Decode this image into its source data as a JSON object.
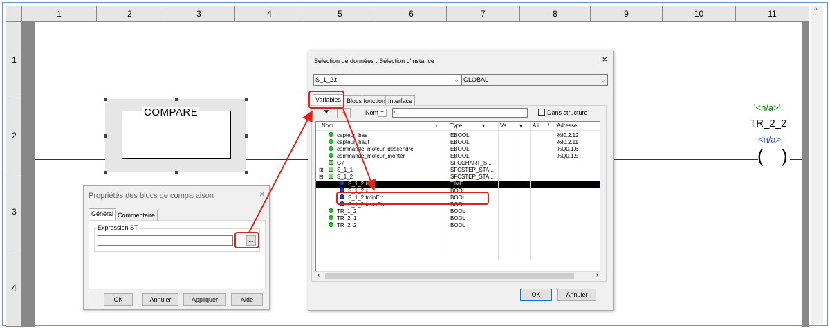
{
  "ladder": {
    "columns": [
      "1",
      "2",
      "3",
      "4",
      "5",
      "6",
      "7",
      "8",
      "9",
      "10",
      "11"
    ],
    "rows": [
      "1",
      "2",
      "3",
      "4"
    ]
  },
  "compare_block": {
    "title": "COMPARE"
  },
  "coil": {
    "assigned": "'<n/a>'",
    "name": "TR_2_2",
    "address": "<n/a>",
    "open": "(",
    "close": ")"
  },
  "properties_dialog": {
    "title": "Propriétés des blocs de comparaison",
    "close": "×",
    "tabs": [
      "Général",
      "Commentaire"
    ],
    "group_label": "Expression ST",
    "expression_value": "",
    "browse_label": "...",
    "buttons": {
      "ok": "OK",
      "cancel": "Annuler",
      "apply": "Appliquer",
      "help": "Aide"
    }
  },
  "selection_dialog": {
    "title": "Sélection de données : Sélection d'instance",
    "close": "×",
    "instance_value": "S_1_2.t",
    "scope_value": "GLOBAL",
    "tabs": [
      "Variables",
      "Blocs fonction",
      "Interface"
    ],
    "filter": {
      "name_label": "Nom",
      "equals": "=",
      "value": "*",
      "structure_label": "Dans structure"
    },
    "columns": [
      "Nom",
      "Type",
      "Va...",
      "Ali...",
      "Adresse"
    ],
    "rows": [
      {
        "indent": 0,
        "icon": "green",
        "name": "capteur_bas",
        "type": "EBOOL",
        "address": "%I0.2.12"
      },
      {
        "indent": 0,
        "icon": "green",
        "name": "capteur_haut",
        "type": "EBOOL",
        "address": "%I0.2.11"
      },
      {
        "indent": 0,
        "icon": "green",
        "name": "commande_moteur_descendre",
        "type": "EBOOL",
        "address": "%Q0.1.6"
      },
      {
        "indent": 0,
        "icon": "green",
        "name": "commande_moteur_monter",
        "type": "EBOOL",
        "address": "%Q0.1.5"
      },
      {
        "indent": 0,
        "icon": "sq",
        "name": "G7",
        "type": "SFCCHART_S...",
        "address": ""
      },
      {
        "indent": 0,
        "icon": "sq",
        "name": "S_1_1",
        "type": "SFCSTEP_STA...",
        "address": "",
        "expander": "⊞"
      },
      {
        "indent": 0,
        "icon": "sq",
        "name": "S_1_2",
        "type": "SFCSTEP_STA...",
        "address": "",
        "expander": "⊟"
      },
      {
        "indent": 1,
        "icon": "blue",
        "name": "S_1_2.t",
        "type": "TIME",
        "address": "",
        "selected": true
      },
      {
        "indent": 1,
        "icon": "blue",
        "name": "S_1_2.x",
        "type": "BOOL",
        "address": ""
      },
      {
        "indent": 1,
        "icon": "blue",
        "name": "S_1_2.tminErr",
        "type": "BOOL",
        "address": ""
      },
      {
        "indent": 1,
        "icon": "blue",
        "name": "S_1_2.tmaxErr",
        "type": "BOOL",
        "address": ""
      },
      {
        "indent": 0,
        "icon": "green",
        "name": "TR_1_2",
        "type": "BOOL",
        "address": ""
      },
      {
        "indent": 0,
        "icon": "green",
        "name": "TR_2_1",
        "type": "BOOL",
        "address": ""
      },
      {
        "indent": 0,
        "icon": "green",
        "name": "TR_2_2",
        "type": "BOOL",
        "address": ""
      }
    ],
    "buttons": {
      "ok": "OK",
      "cancel": "Annuler"
    }
  },
  "colors": {
    "annotation": "#e0201b",
    "selection_row": "#000000",
    "frame_border": "#5b9bd5"
  }
}
